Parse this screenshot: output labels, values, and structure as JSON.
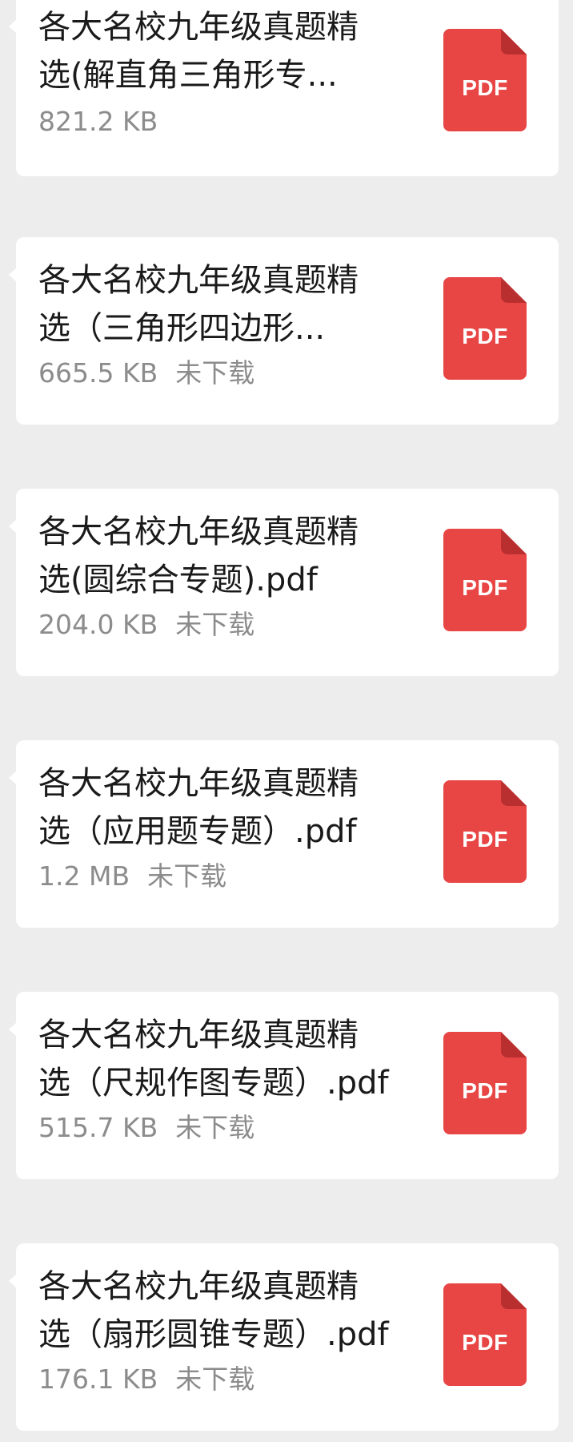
{
  "files": [
    {
      "name_line1": "各大名校九年级真题精",
      "name_line2": "选(解直角三角形专...",
      "size": "821.2 KB",
      "status": "",
      "icon": "pdf-file-icon",
      "icon_label": "PDF"
    },
    {
      "name_line1": "各大名校九年级真题精",
      "name_line2": "选（三角形四边形...",
      "size": "665.5 KB",
      "status": "未下载",
      "icon": "pdf-file-icon",
      "icon_label": "PDF"
    },
    {
      "name_line1": "各大名校九年级真题精",
      "name_line2": "选(圆综合专题).pdf",
      "size": "204.0 KB",
      "status": "未下载",
      "icon": "pdf-file-icon",
      "icon_label": "PDF"
    },
    {
      "name_line1": "各大名校九年级真题精",
      "name_line2": "选（应用题专题）.pdf",
      "size": "1.2 MB",
      "status": "未下载",
      "icon": "pdf-file-icon",
      "icon_label": "PDF"
    },
    {
      "name_line1": "各大名校九年级真题精",
      "name_line2": "选（尺规作图专题）.pdf",
      "size": "515.7 KB",
      "status": "未下载",
      "icon": "pdf-file-icon",
      "icon_label": "PDF"
    },
    {
      "name_line1": "各大名校九年级真题精",
      "name_line2": "选（扇形圆锥专题）.pdf",
      "size": "176.1 KB",
      "status": "未下载",
      "icon": "pdf-file-icon",
      "icon_label": "PDF"
    }
  ],
  "colors": {
    "background": "#ededed",
    "bubble": "#ffffff",
    "pdf_red": "#e84545",
    "pdf_fold": "#b92f2f",
    "meta_gray": "#8c8c8c"
  }
}
